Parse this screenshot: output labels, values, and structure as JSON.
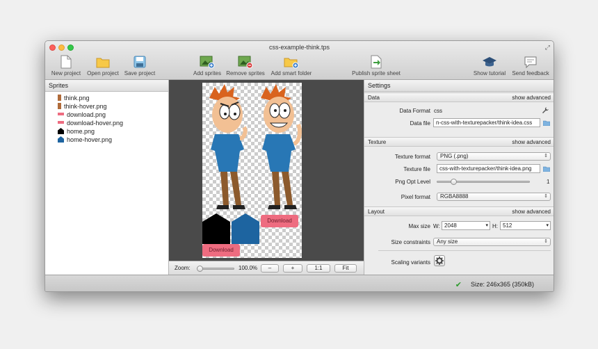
{
  "window": {
    "title": "css-example-think.tps"
  },
  "toolbar": {
    "new_project": "New project",
    "open_project": "Open project",
    "save_project": "Save project",
    "add_sprites": "Add sprites",
    "remove_sprites": "Remove sprites",
    "add_smart_folder": "Add smart folder",
    "publish": "Publish sprite sheet",
    "show_tutorial": "Show tutorial",
    "send_feedback": "Send feedback"
  },
  "sprites": {
    "header": "Sprites",
    "items": [
      {
        "name": "think.png",
        "swatch": "#b06b3a"
      },
      {
        "name": "think-hover.png",
        "swatch": "#b06b3a"
      },
      {
        "name": "download.png",
        "swatch": "#ee6c80"
      },
      {
        "name": "download-hover.png",
        "swatch": "#ee6c80"
      },
      {
        "name": "home.png",
        "swatch": "#000000"
      },
      {
        "name": "home-hover.png",
        "swatch": "#1d64a0"
      }
    ]
  },
  "canvas": {
    "download_label_1": "Download",
    "download_label_2": "Download"
  },
  "zoom": {
    "label": "Zoom:",
    "value": "100.0%",
    "minus": "–",
    "plus": "+",
    "one_to_one": "1:1",
    "fit": "Fit"
  },
  "settings": {
    "header": "Settings",
    "data_section": "Data",
    "texture_section": "Texture",
    "layout_section": "Layout",
    "show_advanced": "show advanced",
    "data_format_label": "Data Format",
    "data_format_value": "css",
    "data_file_label": "Data file",
    "data_file_value": "n-css-with-texturepacker/think-idea.css",
    "texture_format_label": "Texture format",
    "texture_format_value": "PNG (.png)",
    "texture_file_label": "Texture file",
    "texture_file_value": "css-with-texturepacker/think-idea.png",
    "png_opt_label": "Png Opt Level",
    "png_opt_value": "1",
    "pixel_format_label": "Pixel format",
    "pixel_format_value": "RGBA8888",
    "max_size_label": "Max size",
    "w_label": "W:",
    "w_value": "2048",
    "h_label": "H:",
    "h_value": "512",
    "size_constraints_label": "Size constraints",
    "size_constraints_value": "Any size",
    "scaling_variants_label": "Scaling variants"
  },
  "status": {
    "text": "Size: 246x365 (350kB)"
  }
}
